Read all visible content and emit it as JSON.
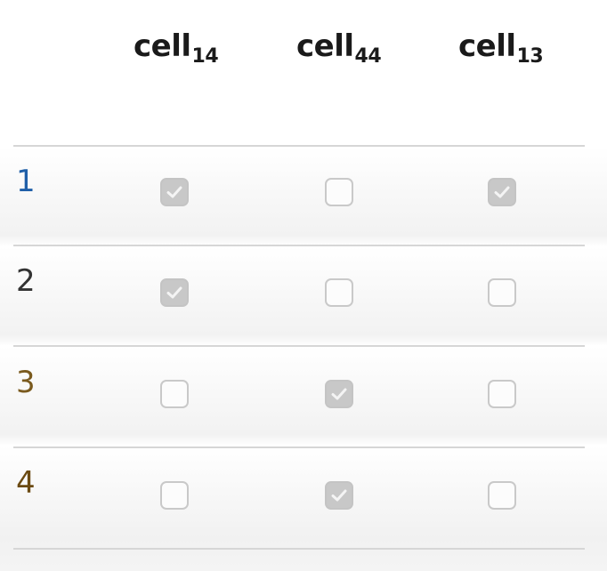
{
  "columns": [
    {
      "base": "cell",
      "sub": "14"
    },
    {
      "base": "cell",
      "sub": "44"
    },
    {
      "base": "cell",
      "sub": "13"
    }
  ],
  "rows": [
    {
      "label": "1",
      "label_color": "#1f5fa8",
      "checks": [
        true,
        false,
        true
      ]
    },
    {
      "label": "2",
      "label_color": "#333333",
      "checks": [
        true,
        false,
        false
      ]
    },
    {
      "label": "3",
      "label_color": "#7a5a1e",
      "checks": [
        false,
        true,
        false
      ]
    },
    {
      "label": "4",
      "label_color": "#6b4a12",
      "checks": [
        false,
        true,
        false
      ]
    }
  ]
}
